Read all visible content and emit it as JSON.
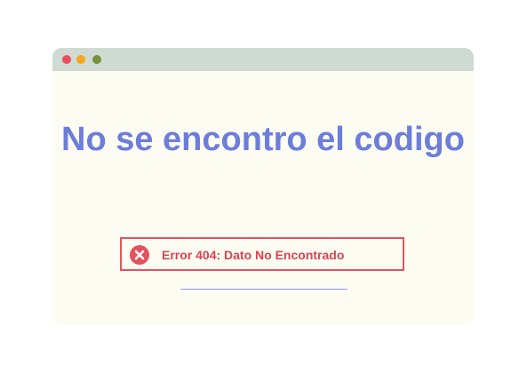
{
  "window": {
    "controls": [
      "close-dot",
      "minimize-dot",
      "maximize-dot"
    ]
  },
  "content": {
    "headline": "No se encontro el codigo",
    "error": {
      "icon": "error-x-circle-icon",
      "message": "Error 404: Dato No Encontrado"
    }
  },
  "colors": {
    "headline": "#6c7ddb",
    "error": "#e3535f",
    "window_bg": "#fdfcf2",
    "titlebar": "#cfdbd2"
  }
}
